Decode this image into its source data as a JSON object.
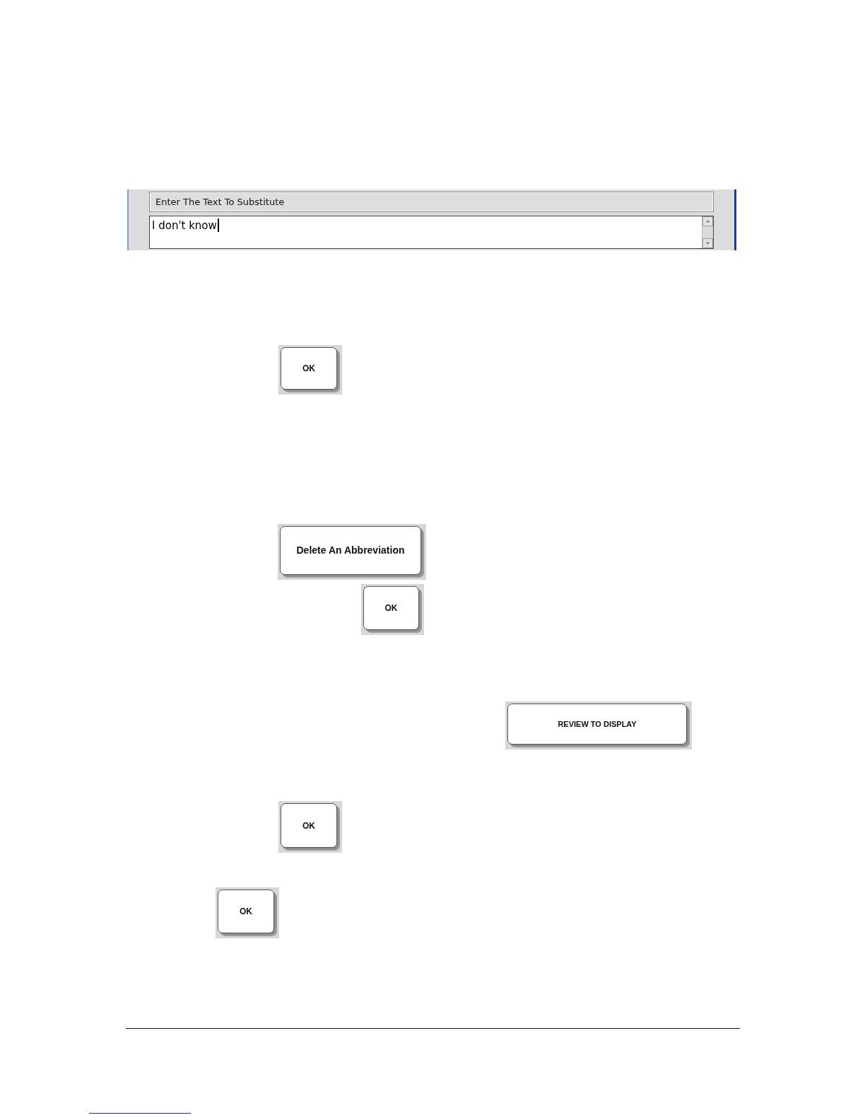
{
  "panel": {
    "label": "Enter The Text To Substitute",
    "text_field": {
      "value": "I don't know",
      "focused": true
    }
  },
  "buttons": [
    {
      "label": "OK"
    },
    {
      "label": "Delete An Abbreviation"
    },
    {
      "label": "OK"
    },
    {
      "label": "REVIEW TO DISPLAY"
    },
    {
      "label": "OK"
    },
    {
      "label": "OK"
    }
  ]
}
